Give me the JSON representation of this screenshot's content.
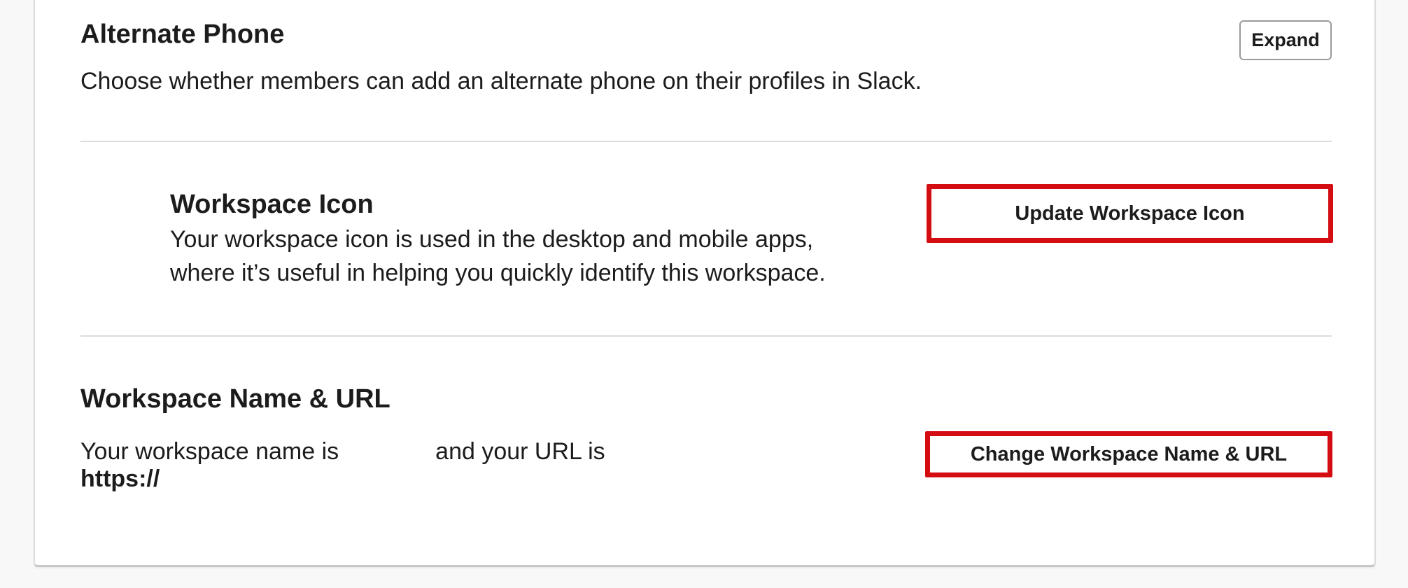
{
  "alternate_phone": {
    "title": "Alternate Phone",
    "description": "Choose whether members can add an alternate phone on their profiles in Slack.",
    "expand_label": "Expand"
  },
  "workspace_icon": {
    "title": "Workspace Icon",
    "description_line1": "Your workspace icon is used in the desktop and mobile apps,",
    "description_line2": "where it’s useful in helping you quickly identify this workspace.",
    "button_label": "Update Workspace Icon"
  },
  "workspace_name": {
    "title": "Workspace Name & URL",
    "text_prefix": "Your workspace name is",
    "text_middle": "and your URL is",
    "url_prefix": "https://",
    "button_label": "Change Workspace Name & URL"
  },
  "colors": {
    "highlight_border": "#d40d12",
    "text": "#1d1c1d",
    "divider": "#dddddd"
  }
}
